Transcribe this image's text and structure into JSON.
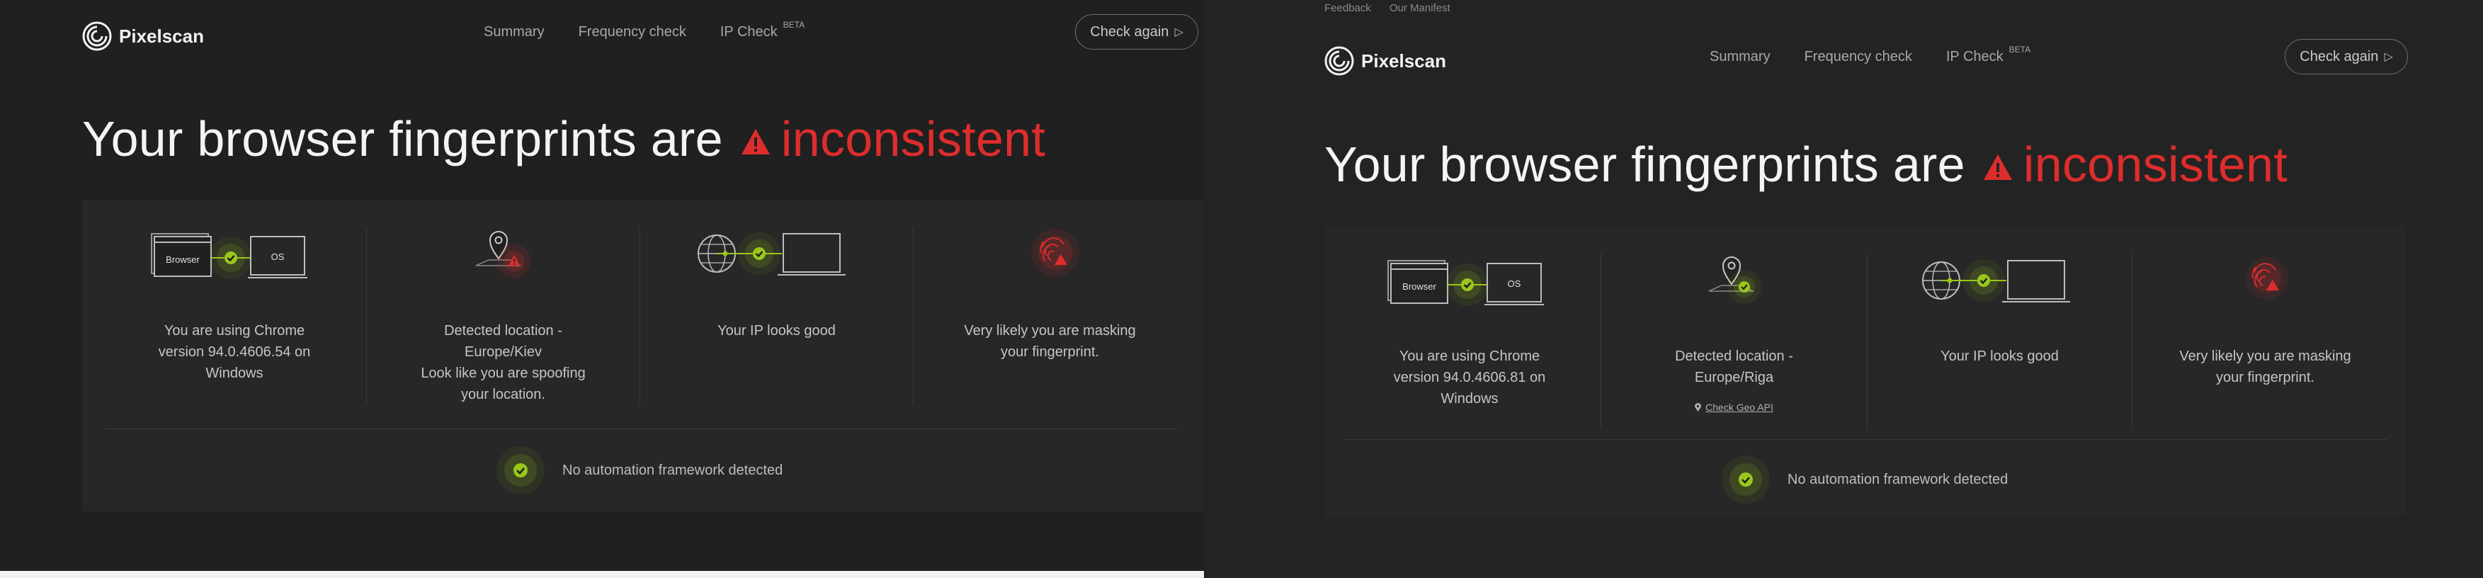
{
  "colors": {
    "accent_red": "#de2d2d",
    "accent_green": "#9ac71b",
    "background": "#202020"
  },
  "left": {
    "logo_text": "Pixelscan",
    "nav": [
      {
        "label": "Summary"
      },
      {
        "label": "Frequency check"
      },
      {
        "label": "IP Check",
        "badge": "BETA"
      }
    ],
    "check_again": "Check again",
    "title_prefix": "Your browser fingerprints are",
    "title_status": "inconsistent",
    "cards": [
      {
        "icon": "browser-os-check-icon",
        "browser_label": "Browser",
        "os_label": "OS",
        "lines": [
          "You are using Chrome",
          "version 94.0.4606.54 on",
          "Windows"
        ]
      },
      {
        "icon": "location-warning-icon",
        "lines": [
          "Detected location -",
          "Europe/Kiev",
          "Look like you are spoofing",
          "your location."
        ]
      },
      {
        "icon": "globe-laptop-check-icon",
        "lines": [
          "Your IP looks good"
        ]
      },
      {
        "icon": "fingerprint-warning-icon",
        "lines": [
          "Very likely you are masking",
          "your fingerprint."
        ]
      }
    ],
    "automation": "No automation framework detected"
  },
  "right": {
    "topbar": [
      "Feedback",
      "Our Manifest"
    ],
    "logo_text": "Pixelscan",
    "nav": [
      {
        "label": "Summary"
      },
      {
        "label": "Frequency check"
      },
      {
        "label": "IP Check",
        "badge": "BETA"
      }
    ],
    "check_again": "Check again",
    "title_prefix": "Your browser fingerprints are",
    "title_status": "inconsistent",
    "cards": [
      {
        "icon": "browser-os-check-icon",
        "browser_label": "Browser",
        "os_label": "OS",
        "lines": [
          "You are using Chrome",
          "version 94.0.4606.81 on",
          "Windows"
        ]
      },
      {
        "icon": "location-check-icon",
        "lines": [
          "Detected location -",
          "Europe/Riga"
        ],
        "link": "Check Geo API"
      },
      {
        "icon": "globe-laptop-check-icon",
        "lines": [
          "Your IP looks good"
        ]
      },
      {
        "icon": "fingerprint-warning-icon",
        "lines": [
          "Very likely you are masking",
          "your fingerprint."
        ]
      }
    ],
    "automation": "No automation framework detected"
  }
}
